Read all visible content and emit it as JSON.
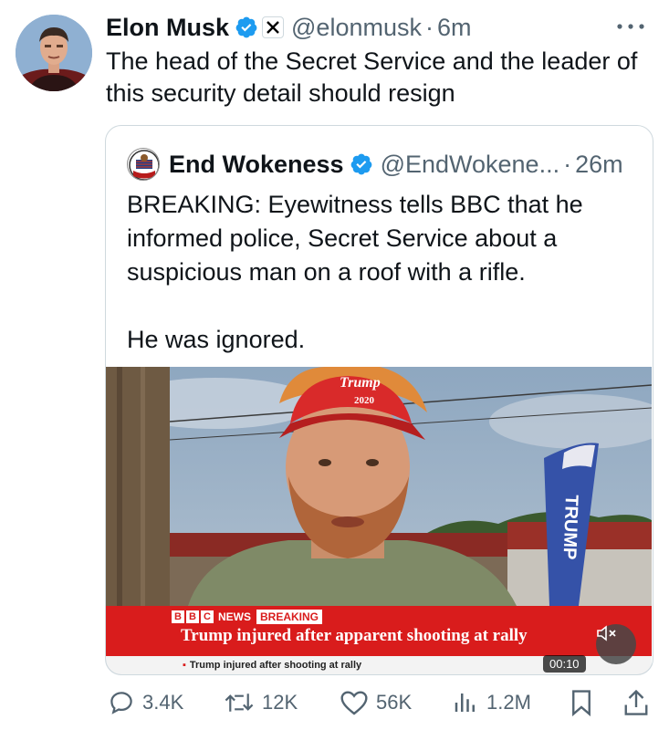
{
  "tweet": {
    "author_name": "Elon Musk",
    "handle": "@elonmusk",
    "separator": "·",
    "time": "6m",
    "text": "The head of the Secret Service and the leader of this security detail should resign"
  },
  "quoted": {
    "author_name": "End Wokeness",
    "handle": "@EndWokene...",
    "separator": "·",
    "time": "26m",
    "text_lines": [
      "BREAKING: Eyewitness tells BBC that he informed police, Secret Service about a suspicious man on a roof with a rifle.",
      "He was ignored."
    ],
    "media": {
      "hat_text": "Trump",
      "hat_year": "2020",
      "flag_text": "TRUMP",
      "bbc_boxes": [
        "B",
        "B",
        "C"
      ],
      "bbc_news": "NEWS",
      "bbc_breaking": "BREAKING",
      "headline": "Trump injured after apparent shooting at rally",
      "ticker": "Trump injured after shooting at rally",
      "duration": "00:10"
    }
  },
  "actions": {
    "replies": "3.4K",
    "reposts": "12K",
    "likes": "56K",
    "views": "1.2M"
  },
  "colors": {
    "verified": "#1d9bf0",
    "secondary_text": "#536471",
    "bbc_red": "#d91c1c",
    "border": "#cfd9de"
  }
}
